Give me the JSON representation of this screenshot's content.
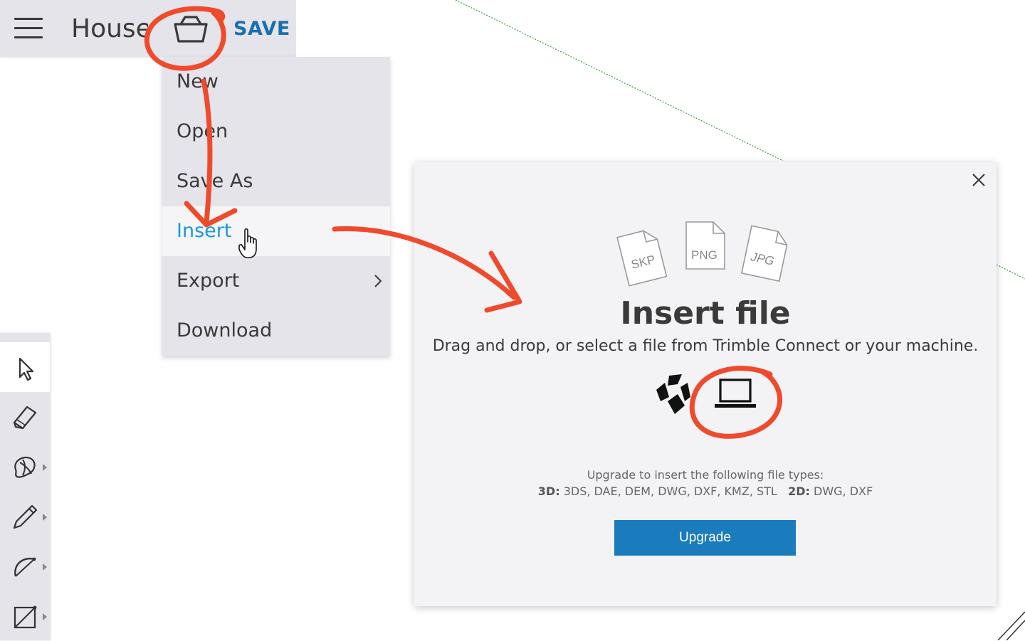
{
  "header": {
    "menu_icon": "hamburger-menu-icon",
    "doc_title": "House",
    "file_icon": "basket-icon",
    "save_label": "SAVE"
  },
  "file_menu": {
    "items": [
      {
        "label": "New"
      },
      {
        "label": "Open"
      },
      {
        "label": "Save As"
      },
      {
        "label": "Insert",
        "state": "hover"
      },
      {
        "label": "Export",
        "has_submenu": true
      },
      {
        "label": "Download"
      }
    ]
  },
  "toolbar": {
    "tools": [
      {
        "icon": "select-arrow-icon",
        "selected": true
      },
      {
        "icon": "eraser-icon"
      },
      {
        "icon": "paint-bucket-icon",
        "has_submenu": true
      },
      {
        "icon": "pencil-icon",
        "has_submenu": true
      },
      {
        "icon": "arc-icon",
        "has_submenu": true
      },
      {
        "icon": "rectangle-icon",
        "has_submenu": true
      }
    ]
  },
  "dialog": {
    "file_type_icons": [
      "SKP",
      "PNG",
      "JPG"
    ],
    "title": "Insert file",
    "subtitle": "Drag and drop, or select a file from Trimble Connect or your machine.",
    "sources": [
      "trimble-connect-icon",
      "laptop-icon"
    ],
    "upgrade_note": "Upgrade to insert the following file types:",
    "types_3d_label": "3D:",
    "types_3d": "3DS, DAE, DEM, DWG, DXF, KMZ, STL",
    "types_2d_label": "2D:",
    "types_2d": "DWG, DXF",
    "upgrade_button": "Upgrade",
    "close_icon": "close-icon"
  },
  "colors": {
    "accent": "#1a6fb0",
    "active_menu_text": "#1e9ad6",
    "upgrade_button": "#1a7bbd",
    "annotation": "#f04a2c",
    "panel_bg": "#e4e4ea"
  }
}
